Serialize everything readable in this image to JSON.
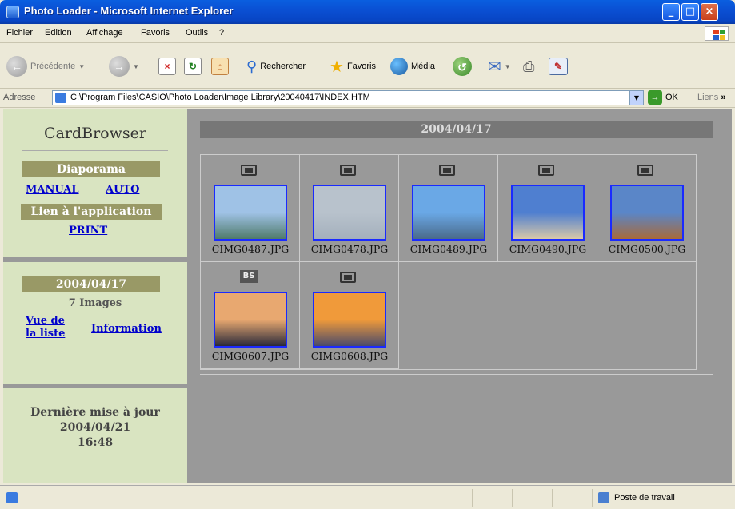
{
  "window": {
    "title": "Photo Loader - Microsoft Internet Explorer"
  },
  "menu": [
    "Fichier",
    "Edition",
    "Affichage",
    "Favoris",
    "Outils",
    "?"
  ],
  "toolbar": {
    "back": "Précédente",
    "search": "Rechercher",
    "favorites": "Favoris",
    "media": "Média"
  },
  "address": {
    "label": "Adresse",
    "url": "C:\\Program Files\\CASIO\\Photo Loader\\Image Library\\20040417\\INDEX.HTM",
    "go": "OK",
    "links": "Liens"
  },
  "sidebar": {
    "brand": "CardBrowser",
    "slideshow": "Diaporama",
    "manual": "MANUAL",
    "auto": "AUTO",
    "app_link": "Lien à l'application",
    "print": "PRINT",
    "date": "2004/04/17",
    "count": "7 Images",
    "list_view": "Vue de la liste",
    "information": "Information",
    "last_update_label": "Dernière mise à jour",
    "last_update_date": "2004/04/21",
    "last_update_time": "16:48"
  },
  "main": {
    "date": "2004/04/17"
  },
  "images": [
    {
      "name": "CIMG0487.JPG",
      "badge": "",
      "colors": [
        "#9fc2e6",
        "#4f7a6a"
      ]
    },
    {
      "name": "CIMG0478.JPG",
      "badge": "",
      "colors": [
        "#b8c2cc",
        "#a4b0bc"
      ]
    },
    {
      "name": "CIMG0489.JPG",
      "badge": "",
      "colors": [
        "#6aa8e6",
        "#4a6a8a"
      ]
    },
    {
      "name": "CIMG0490.JPG",
      "badge": "",
      "colors": [
        "#4f7fd0",
        "#d8c8a8"
      ]
    },
    {
      "name": "CIMG0500.JPG",
      "badge": "",
      "colors": [
        "#5a86c8",
        "#a86a3a"
      ]
    },
    {
      "name": "CIMG0607.JPG",
      "badge": "BS",
      "colors": [
        "#e8a870",
        "#2a2a3a"
      ]
    },
    {
      "name": "CIMG0608.JPG",
      "badge": "",
      "colors": [
        "#f09a3a",
        "#4a4a6a"
      ]
    }
  ],
  "status": {
    "zone": "Poste de travail"
  }
}
